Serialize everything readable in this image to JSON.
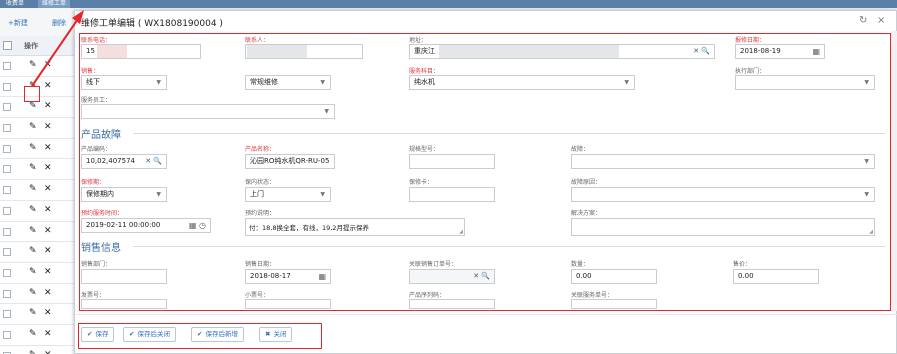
{
  "app": {
    "tabs": [
      "收费单",
      "维修工单"
    ],
    "toolbar": {
      "add_label": "+新建",
      "del_label": "删除"
    },
    "grid": {
      "op_header": "操作",
      "row_count": 15
    }
  },
  "modal": {
    "title": "维修工单编辑 ( WX1808190004 )",
    "refresh_icon": "↻",
    "close_icon": "×"
  },
  "form": {
    "phone": {
      "label": "联系电话：",
      "value": "15"
    },
    "contact": {
      "label": "联系人：",
      "value": ""
    },
    "address": {
      "label": "地址：",
      "value": "重庆江"
    },
    "report_date": {
      "label": "报修日期：",
      "value": "2018-08-19"
    },
    "sales": {
      "label": "销售：",
      "value": "线下"
    },
    "service_type": {
      "label": "",
      "value": "常规维修"
    },
    "service_subject": {
      "label": "服务科目：",
      "value": "纯水机"
    },
    "exec_dept": {
      "label": "执行部门：",
      "value": ""
    },
    "staff": {
      "label": "服务员工：",
      "value": ""
    }
  },
  "sections": {
    "fault": "产品故障",
    "sales_info": "销售信息"
  },
  "fault": {
    "product_code": {
      "label": "产品编码：",
      "value": "10,02,407574"
    },
    "product_name": {
      "label": "产品名称：",
      "value": "沁园RO纯水机QR-RU-05"
    },
    "model": {
      "label": "规格型号：",
      "value": ""
    },
    "fault": {
      "label": "故障：",
      "value": ""
    },
    "warranty": {
      "label": "保修期：",
      "value": "保修期内"
    },
    "warranty_status": {
      "label": "保内状态：",
      "value": "上门"
    },
    "warranty_card": {
      "label": "保修卡：",
      "value": ""
    },
    "fault_reason": {
      "label": "故障原因：",
      "value": ""
    },
    "appointment": {
      "label": "预约服务时间：",
      "value": "2019-02-11 00:00:00"
    },
    "appointment_note": {
      "label": "预约说明：",
      "value": "付：18,8换全套，有线，19,2月提示保养"
    },
    "solution": {
      "label": "解决方案：",
      "value": ""
    }
  },
  "sales": {
    "dept": {
      "label": "销售部门：",
      "value": ""
    },
    "date": {
      "label": "销售日期：",
      "value": "2018-08-17"
    },
    "order_no": {
      "label": "关联销售订单号：",
      "value": ""
    },
    "qty": {
      "label": "数量：",
      "value": "0.00"
    },
    "price": {
      "label": "售价：",
      "value": "0.00"
    },
    "invoice": {
      "label": "发票号：",
      "value": ""
    },
    "receipt": {
      "label": "小票号：",
      "value": ""
    },
    "serial": {
      "label": "产品序列码：",
      "value": ""
    },
    "service_no": {
      "label": "关联服务单号：",
      "value": ""
    }
  },
  "footer": {
    "save": "保存",
    "save_close": "保存后关闭",
    "save_new": "保存后新增",
    "close": "关闭"
  }
}
